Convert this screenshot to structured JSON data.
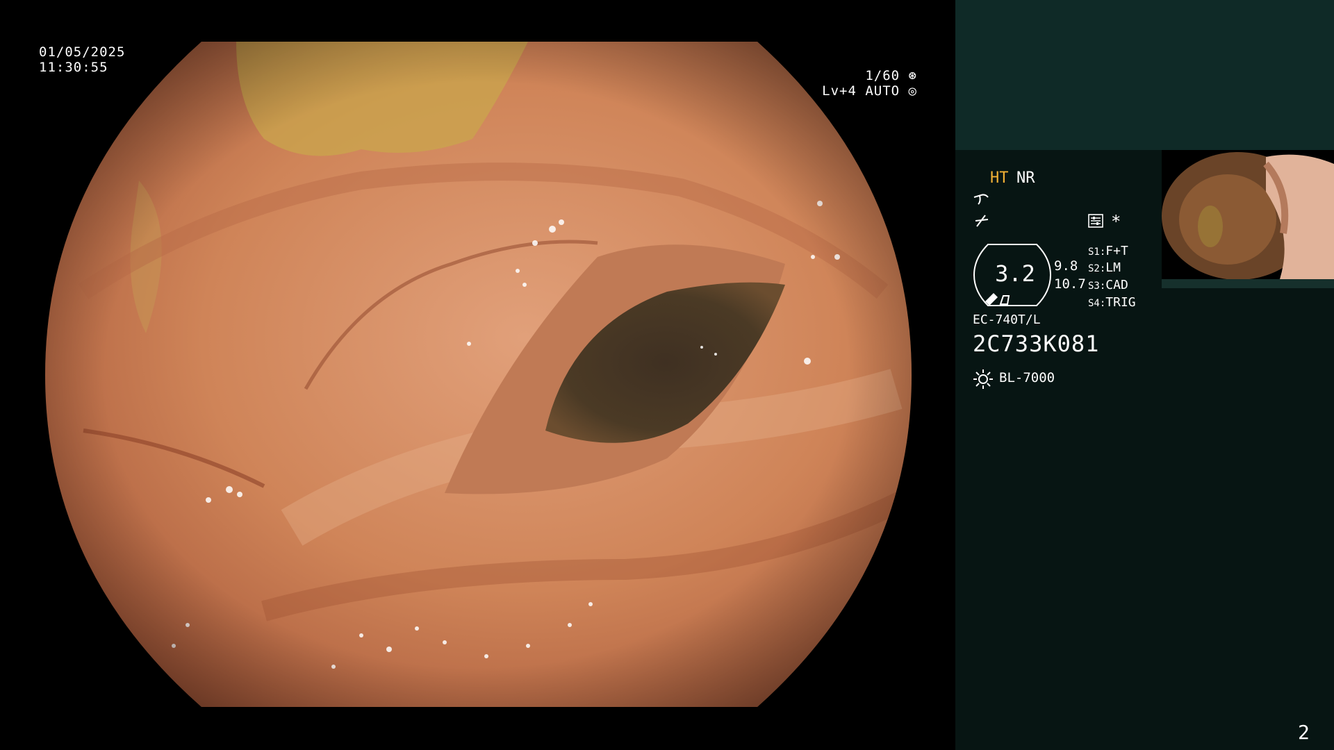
{
  "osd": {
    "date": "01/05/2025",
    "time": "11:30:55",
    "shutter": "1/60",
    "level": "Lv+4 AUTO"
  },
  "panel": {
    "mode_ht": "HT",
    "mode_nr": "NR",
    "star": "*",
    "zoom": "3.2",
    "zoom_sub_1": "9.8",
    "zoom_sub_2": "10.7",
    "slots": [
      {
        "key": "S1:",
        "value": "F+T"
      },
      {
        "key": "S2:",
        "value": "LM"
      },
      {
        "key": "S3:",
        "value": "CAD"
      },
      {
        "key": "S4:",
        "value": "TRIG"
      }
    ],
    "scope_model": "EC-740T/L",
    "scope_serial": "2C733K081",
    "light_source": "BL-7000",
    "page_number": "2"
  },
  "colors": {
    "accent_ht": "#f2b135",
    "panel_top": "#0f2a27",
    "panel_main": "#071513"
  },
  "icons": [
    "shutter-icon",
    "auto-iris-icon",
    "wave-icon",
    "enhance-icon",
    "settings-icon",
    "light-source-icon",
    "pen-icon",
    "flag-icon"
  ]
}
